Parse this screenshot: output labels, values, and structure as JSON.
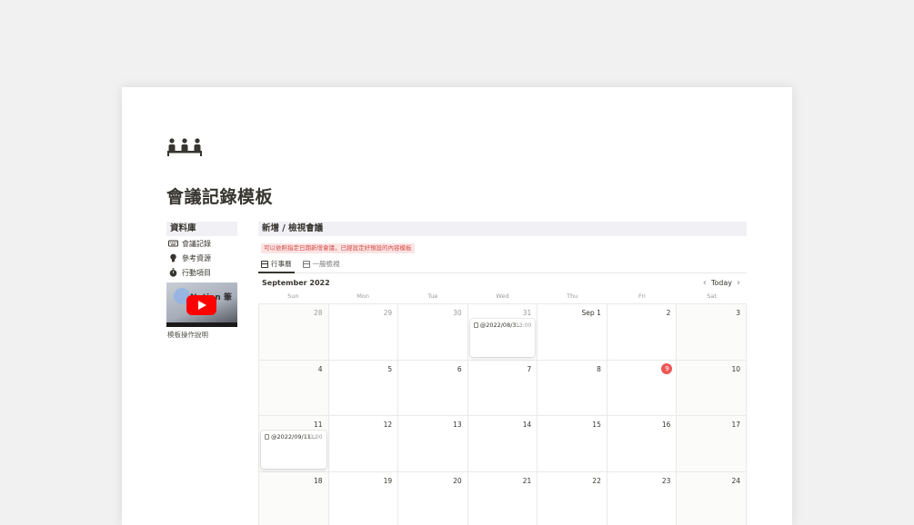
{
  "page": {
    "icon": "people-meeting-icon",
    "title": "會議記錄模板"
  },
  "sidebar": {
    "header": "資料庫",
    "links": [
      {
        "label": "會議記錄",
        "icon": "keyboard-icon"
      },
      {
        "label": "參考資源",
        "icon": "lightbulb-icon"
      },
      {
        "label": "行動項目",
        "icon": "stopwatch-icon"
      }
    ],
    "video": {
      "overlay_text": "Notion 筆記",
      "icon": "youtube-play-icon",
      "caption": "模板操作說明"
    }
  },
  "main": {
    "header": "新增 / 檢視會議",
    "note": "可以依照指定日期新增會議，已經設定好預設的內容模板",
    "tabs": [
      {
        "label": "行事曆",
        "active": true
      },
      {
        "label": "一般檢視",
        "active": false
      }
    ],
    "calendar": {
      "month_label": "September 2022",
      "today_label": "Today",
      "prev_icon": "chevron-left-icon",
      "next_icon": "chevron-right-icon",
      "weekdays": [
        "Sun",
        "Mon",
        "Tue",
        "Wed",
        "Thu",
        "Fri",
        "Sat"
      ],
      "today_day": "9",
      "accent_color": "#eb5757",
      "days": [
        {
          "label": "28",
          "dim": true
        },
        {
          "label": "29",
          "dim": true
        },
        {
          "label": "30",
          "dim": true
        },
        {
          "label": "31",
          "dim": true,
          "event": {
            "title": "@2022/08/3...",
            "time": "13:00"
          }
        },
        {
          "label": "Sep 1",
          "dim": false
        },
        {
          "label": "2",
          "dim": false
        },
        {
          "label": "3",
          "dim": false
        },
        {
          "label": "4",
          "dim": false
        },
        {
          "label": "5",
          "dim": false
        },
        {
          "label": "6",
          "dim": false
        },
        {
          "label": "7",
          "dim": false
        },
        {
          "label": "8",
          "dim": false
        },
        {
          "label": "9",
          "dim": false,
          "today": true
        },
        {
          "label": "10",
          "dim": false
        },
        {
          "label": "11",
          "dim": false,
          "event": {
            "title": "@2022/09/11...",
            "time": "13:00"
          }
        },
        {
          "label": "12",
          "dim": false
        },
        {
          "label": "13",
          "dim": false
        },
        {
          "label": "14",
          "dim": false
        },
        {
          "label": "15",
          "dim": false
        },
        {
          "label": "16",
          "dim": false
        },
        {
          "label": "17",
          "dim": false
        },
        {
          "label": "18",
          "dim": false
        },
        {
          "label": "19",
          "dim": false
        },
        {
          "label": "20",
          "dim": false
        },
        {
          "label": "21",
          "dim": false
        },
        {
          "label": "22",
          "dim": false
        },
        {
          "label": "23",
          "dim": false
        },
        {
          "label": "24",
          "dim": false
        }
      ]
    }
  }
}
